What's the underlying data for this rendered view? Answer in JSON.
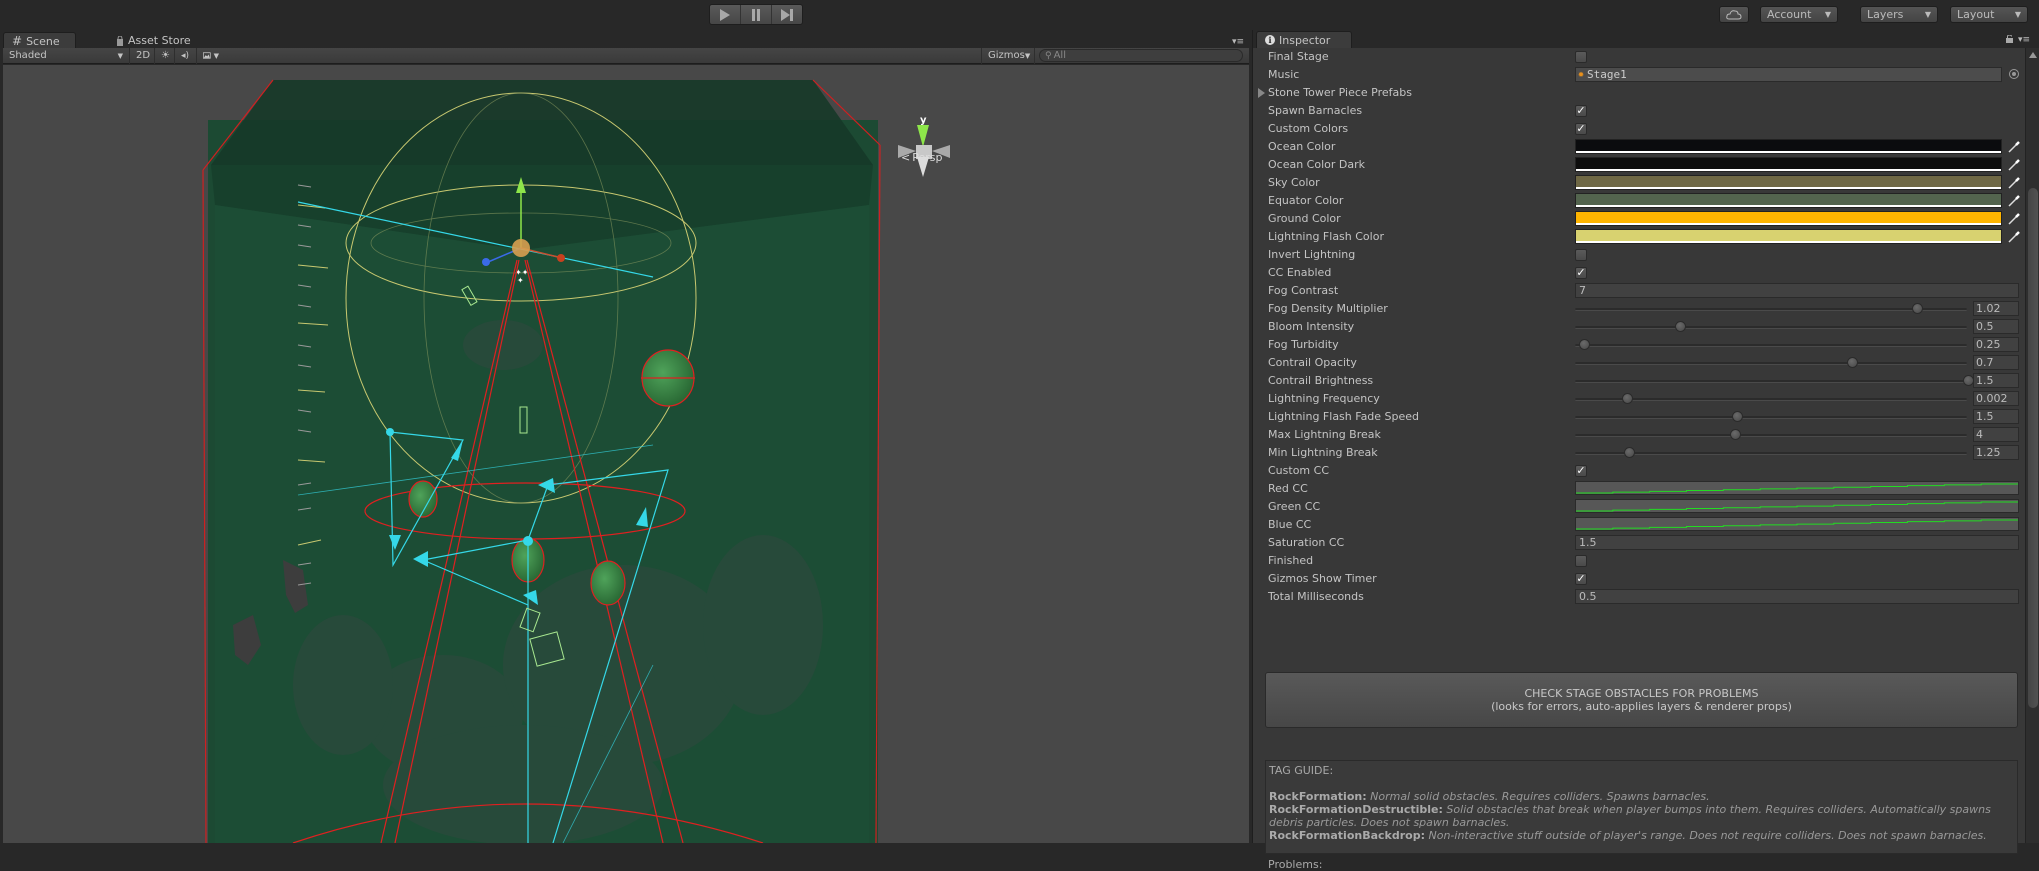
{
  "toolbar": {
    "play_icon": "play-icon",
    "pause_icon": "pause-icon",
    "step_icon": "step-icon",
    "cloud_icon": "cloud-icon",
    "account_label": "Account",
    "layers_label": "Layers",
    "layout_label": "Layout"
  },
  "scene": {
    "tabs": [
      {
        "label": "Scene",
        "icon": "grid-icon",
        "active": true
      },
      {
        "label": "Asset Store",
        "icon": "shopping-bag-icon",
        "active": false
      }
    ],
    "shading_mode": "Shaded",
    "mode_2d": "2D",
    "gizmos_label": "Gizmos",
    "search_placeholder": "All",
    "projection_label": "Persp",
    "axis_label": "y"
  },
  "inspector": {
    "tab_label": "Inspector",
    "rows": [
      {
        "label": "Final Stage",
        "type": "checkbox",
        "checked": false
      },
      {
        "label": "Music",
        "type": "object",
        "value": "Stage1"
      },
      {
        "label": "Stone Tower Piece Prefabs",
        "type": "foldout"
      },
      {
        "label": "Spawn Barnacles",
        "type": "checkbox",
        "checked": true
      },
      {
        "label": "Custom Colors",
        "type": "checkbox",
        "checked": true
      },
      {
        "label": "Ocean Color",
        "type": "color",
        "color": "#0b0c0e"
      },
      {
        "label": "Ocean Color Dark",
        "type": "color",
        "color": "#0d0d0d"
      },
      {
        "label": "Sky Color",
        "type": "color",
        "color": "#6f6845"
      },
      {
        "label": "Equator Color",
        "type": "color",
        "color": "#53644e"
      },
      {
        "label": "Ground Color",
        "type": "color",
        "color": "#ffb500"
      },
      {
        "label": "Lightning Flash Color",
        "type": "color",
        "color": "#d8d270"
      },
      {
        "label": "Invert Lightning",
        "type": "checkbox",
        "checked": false
      },
      {
        "label": "CC Enabled",
        "type": "checkbox",
        "checked": true
      },
      {
        "label": "Fog Contrast",
        "type": "number",
        "value": "7"
      },
      {
        "label": "Fog Density Multiplier",
        "type": "slider",
        "value": "1.02",
        "fraction": 0.86
      },
      {
        "label": "Bloom Intensity",
        "type": "slider",
        "value": "0.5",
        "fraction": 0.255
      },
      {
        "label": "Fog Turbidity",
        "type": "slider",
        "value": "0.25",
        "fraction": 0.01
      },
      {
        "label": "Contrail Opacity",
        "type": "slider",
        "value": "0.7",
        "fraction": 0.695
      },
      {
        "label": "Contrail Brightness",
        "type": "slider",
        "value": "1.5",
        "fraction": 0.99
      },
      {
        "label": "Lightning Frequency",
        "type": "slider",
        "value": "0.002",
        "fraction": 0.12
      },
      {
        "label": "Lightning Flash Fade Speed",
        "type": "slider",
        "value": "1.5",
        "fraction": 0.4
      },
      {
        "label": "Max Lightning Break",
        "type": "slider",
        "value": "4",
        "fraction": 0.395
      },
      {
        "label": "Min Lightning Break",
        "type": "slider",
        "value": "1.25",
        "fraction": 0.125
      },
      {
        "label": "Custom CC",
        "type": "checkbox",
        "checked": true
      },
      {
        "label": "Red CC",
        "type": "curve"
      },
      {
        "label": "Green CC",
        "type": "curve"
      },
      {
        "label": "Blue CC",
        "type": "curve"
      },
      {
        "label": "Saturation CC",
        "type": "number",
        "value": "1.5"
      },
      {
        "label": "Finished",
        "type": "checkbox",
        "checked": false
      },
      {
        "label": "Gizmos Show Timer",
        "type": "checkbox",
        "checked": true
      },
      {
        "label": "Total Milliseconds",
        "type": "number",
        "value": "0.5"
      }
    ],
    "check_button": {
      "line1": "CHECK STAGE OBSTACLES FOR PROBLEMS",
      "line2": "(looks for errors, auto-applies layers & renderer props)"
    },
    "tag_guide": {
      "title": "TAG GUIDE:",
      "entries": [
        {
          "tag": "RockFormation:",
          "desc": "Normal solid obstacles. Requires colliders. Spawns barnacles."
        },
        {
          "tag": "RockFormationDestructible:",
          "desc": "Solid obstacles that break when player bumps into them. Requires colliders. Automatically spawns debris particles. Does not spawn barnacles."
        },
        {
          "tag": "RockFormationBackdrop:",
          "desc": "Non-interactive stuff outside of player's range. Does not require colliders. Does not spawn barnacles."
        }
      ]
    },
    "problems_label": "Problems:",
    "curve_color": "#22dd22"
  }
}
